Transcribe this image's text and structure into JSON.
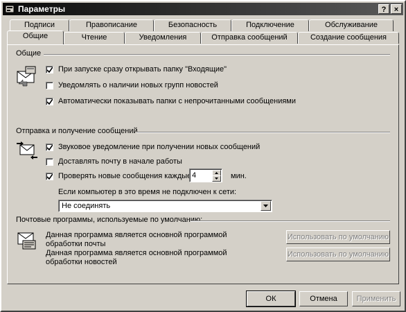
{
  "window": {
    "title": "Параметры",
    "help_label": "?",
    "close_label": "×"
  },
  "tabs": {
    "row1": [
      "Подписи",
      "Правописание",
      "Безопасность",
      "Подключение",
      "Обслуживание"
    ],
    "row2": [
      "Общие",
      "Чтение",
      "Уведомления",
      "Отправка сообщений",
      "Создание сообщения"
    ],
    "active": "Общие"
  },
  "general": {
    "title": "Общие",
    "items": [
      {
        "label": "При запуске сразу открывать папку \"Входящие\"",
        "checked": true
      },
      {
        "label": "Уведомлять о наличии новых групп новостей",
        "checked": false
      },
      {
        "label": "Автоматически показывать папки с непрочитанными сообщениями",
        "checked": true
      }
    ]
  },
  "sendreceive": {
    "title": "Отправка и получение сообщений",
    "items": [
      {
        "label": "Звуковое уведомление при получении новых сообщений",
        "checked": true
      },
      {
        "label": "Доставлять почту в начале работы",
        "checked": false
      },
      {
        "label": "Проверять новые сообщения каждые",
        "checked": true
      }
    ],
    "interval_value": "4",
    "interval_unit": "мин.",
    "offline_label": "Если компьютер в это время не подключен к сети:",
    "offline_selected": "Не соединять"
  },
  "defaults": {
    "title": "Почтовые программы, используемые по умолчанию:",
    "mail_text": "Данная программа является основной программой обработки почты",
    "news_text": "Данная программа является основной программой обработки новостей",
    "mail_button": "Использовать по умолчанию",
    "news_button": "Использовать по умолчанию"
  },
  "buttons": {
    "ok": "ОК",
    "cancel": "Отмена",
    "apply": "Применить"
  },
  "icons": {
    "window": "options-icon",
    "general": "inbox-envelope-icon",
    "sendreceive": "send-receive-icon",
    "defaults": "mail-news-program-icon"
  }
}
